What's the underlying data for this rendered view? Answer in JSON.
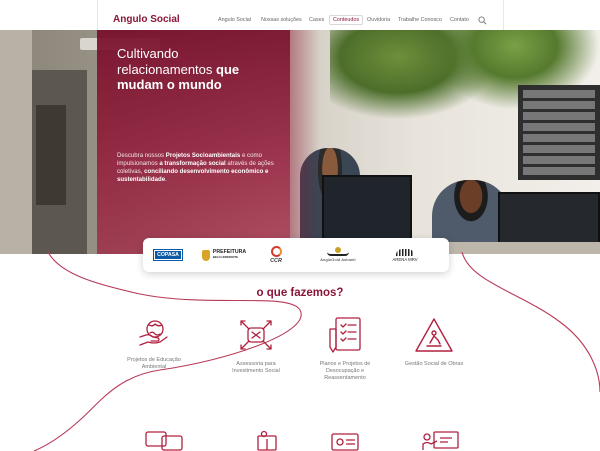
{
  "header": {
    "logo_text": "Angulo Social",
    "nav": [
      {
        "label": "Angulo Social",
        "active": false
      },
      {
        "label": "Nossas soluções",
        "active": false
      },
      {
        "label": "Cases",
        "active": false
      },
      {
        "label": "Conteudos",
        "active": true
      },
      {
        "label": "Ouvidoria",
        "active": false
      },
      {
        "label": "Trabalhe Conosco",
        "active": false
      },
      {
        "label": "Contato",
        "active": false
      }
    ],
    "search_icon": "search-icon"
  },
  "hero": {
    "title_line1": "Cultivando",
    "title_line2": "relacionamentos",
    "title_highlight": "que",
    "title_line3": "mudam o mundo",
    "text_part1": "Descubra nossos ",
    "text_bold1": "Projetos Socioambientais",
    "text_part2": " e como impulsionamos ",
    "text_bold2": "a transformação social",
    "text_part3": " através de ações coletivas, ",
    "text_bold3": "conciliando desenvolvimento econômico e sustentabilidade",
    "text_part4": "."
  },
  "partners": {
    "copasa": "COPASA",
    "pbh_line1": "PREFEITURA",
    "pbh_line2": "BELO HORIZONTE",
    "ccr": "CCR",
    "anglo": "AngloGold Ashanti",
    "arena": "ARENA MRV"
  },
  "services": {
    "title": "o que fazemos?",
    "items": [
      {
        "label": "Projetos de Educação Ambiental",
        "icon": "hands-globe-icon"
      },
      {
        "label": "Assessoria para Investimento Social",
        "icon": "joined-hands-icon"
      },
      {
        "label": "Planos e Projetos de Desocupação e Reassentamento",
        "icon": "checklist-icon"
      },
      {
        "label": "Gestão Social de Obras",
        "icon": "warning-sign-icon"
      }
    ],
    "row2_icons": [
      "chat-bubbles-icon",
      "reading-person-icon",
      "presentation-icon",
      "teaching-board-icon"
    ]
  },
  "colors": {
    "brand": "#8b1538",
    "overlay": "#921636",
    "text_muted": "#777777"
  }
}
